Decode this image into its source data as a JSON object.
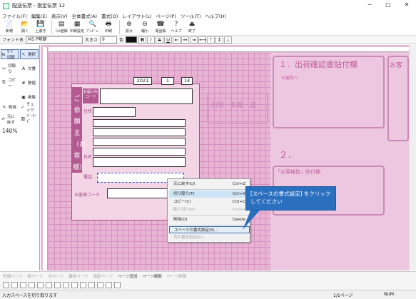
{
  "window": {
    "title": "配送伝票 - 指定伝票 12",
    "minimize": "─",
    "maximize": "□",
    "close": "✕"
  },
  "menu": [
    "ファイル(F)",
    "編集(E)",
    "表示(V)",
    "全体書式(A)",
    "書式(O)",
    "レイアウト(L)",
    "ページ(P)",
    "ツール(T)",
    "ヘルプ(H)"
  ],
  "toolbar": [
    {
      "label": "新規",
      "icon": "📄"
    },
    {
      "label": "開く",
      "icon": "📂"
    },
    {
      "label": "上書き",
      "icon": "💾"
    },
    {
      "label": "ﾌｫﾑ登録",
      "icon": "▤"
    },
    {
      "label": "印刷設定",
      "icon": "▦"
    },
    {
      "label": "ﾌﾟﾚﾋﾞｭｰ",
      "icon": "🔍"
    },
    {
      "label": "印刷",
      "icon": "🖶"
    },
    {
      "label": "拡大",
      "icon": "⊕"
    },
    {
      "label": "縮小",
      "icon": "⊖"
    },
    {
      "label": "電話帳",
      "icon": "☎"
    },
    {
      "label": "ヘルプ",
      "icon": "?"
    },
    {
      "label": "終了",
      "icon": "⏏"
    }
  ],
  "format": {
    "font_label": "フォント名",
    "font_value": "MS P明朝",
    "size_label": "大きさ",
    "size_value": "9",
    "color_label": "色",
    "bold": "B",
    "italic": "I",
    "strike": "S",
    "underline": "U"
  },
  "left_tools": [
    {
      "label": "ﾓｰﾄﾞ切替",
      "icon": "⇆"
    },
    {
      "label": "選択",
      "icon": "↖"
    },
    {
      "label": "切取り",
      "icon": "✂"
    },
    {
      "label": "文書",
      "icon": "A"
    },
    {
      "label": "コピー",
      "icon": "⎘"
    },
    {
      "label": "数値",
      "icon": "#"
    },
    {
      "label": "",
      "icon": ""
    },
    {
      "label": "画像",
      "icon": "▣"
    },
    {
      "label": "削除",
      "icon": "✎"
    },
    {
      "label": "チェック",
      "icon": "✓"
    },
    {
      "label": "元に戻す",
      "icon": "↶"
    },
    {
      "label": "ﾊﾞｰｺｰﾄﾞ",
      "icon": "▥"
    }
  ],
  "zoom": "140%",
  "form": {
    "date_year": "2021",
    "date_month": "1",
    "date_day": "14",
    "vertical_heading": "ご依頼主（お客様）",
    "postal_label": "郵便番号",
    "addr_label": "住所",
    "name_label": "氏名",
    "phone_label": "電話",
    "cust_code_label": "お客様コード",
    "badge_text": "お届け先コード",
    "center_text": "削除・転載・盗",
    "right_title": "１．出荷確認書貼付欄",
    "right_subtitle": "お届先へ",
    "right_num2": "２．",
    "right_subtitle2": "「お客様控」貼付欄",
    "right_corner": "お客"
  },
  "context_menu": {
    "items": [
      {
        "label": "元に戻す(U)",
        "shortcut": "Ctrl+Z",
        "state": "normal"
      },
      {
        "label": "切り取り(T)",
        "shortcut": "Ctrl+X",
        "state": "highlight"
      },
      {
        "label": "コピー(C)",
        "shortcut": "Ctrl+C",
        "state": "normal"
      },
      {
        "label": "貼り付け(V)",
        "shortcut": "Ctrl+V",
        "state": "disabled"
      },
      {
        "label": "削除(D)",
        "shortcut": "Delete",
        "state": "normal"
      },
      {
        "label": "スペースの書式設定(S)...",
        "shortcut": "",
        "state": "selected"
      },
      {
        "label": "列の書式設定(R)...",
        "shortcut": "",
        "state": "disabled"
      }
    ]
  },
  "callout": "[スペースの書式設定] をクリックしてください",
  "bottom_nav": [
    "先頭ページ",
    "前ページ",
    "次ページ",
    "最終ページ",
    "指定ページ",
    "ページ追加",
    "ページ複製",
    "ページ削除"
  ],
  "status": {
    "message": "入力スペースを切り取ります",
    "page": "1/1ページ",
    "num": "NUM"
  },
  "colors": {
    "accent": "#2b6fbf",
    "form_pink": "#b45a92",
    "grid": "#e8b4d4"
  }
}
